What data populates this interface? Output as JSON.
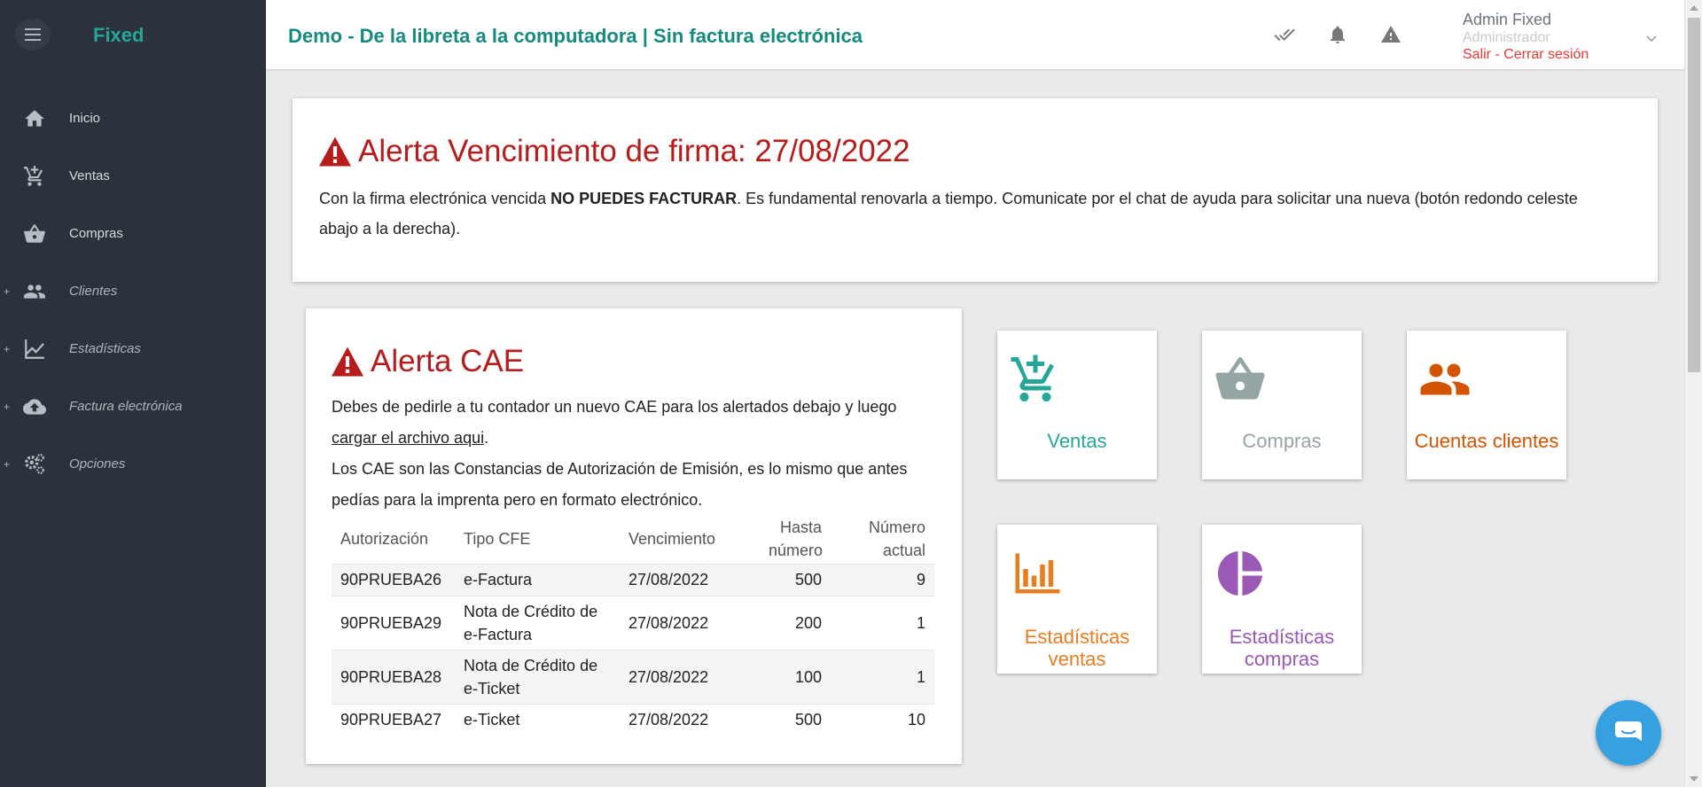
{
  "sidebar": {
    "brand": "Fixed",
    "items": [
      {
        "label": "Inicio",
        "icon": "home-icon",
        "expandable": false
      },
      {
        "label": "Ventas",
        "icon": "cart-plus-icon",
        "expandable": false
      },
      {
        "label": "Compras",
        "icon": "basket-icon",
        "expandable": false
      },
      {
        "label": "Clientes",
        "icon": "people-icon",
        "expandable": true
      },
      {
        "label": "Estadísticas",
        "icon": "chart-line-icon",
        "expandable": true
      },
      {
        "label": "Factura electrónica",
        "icon": "cloud-upload-icon",
        "expandable": true
      },
      {
        "label": "Opciones",
        "icon": "gears-icon",
        "expandable": true
      }
    ],
    "expand_symbol": "+"
  },
  "header": {
    "title": "Demo - De la libreta a la computadora | Sin factura electrónica",
    "icons": [
      "double-check-icon",
      "bell-icon",
      "warning-icon"
    ],
    "user": {
      "name": "Admin Fixed",
      "role": "Administrador",
      "logout": "Salir - Cerrar sesión"
    }
  },
  "alert_firma": {
    "title": "Alerta Vencimiento de firma: 27/08/2022",
    "text_before": "Con la firma electrónica vencida ",
    "text_bold": "NO PUEDES FACTURAR",
    "text_after": ". Es fundamental renovarla a tiempo. Comunicate por el chat de ayuda para solicitar una nueva (botón redondo celeste abajo a la derecha)."
  },
  "alert_cae": {
    "title": "Alerta CAE",
    "text1": "Debes de pedirle a tu contador un nuevo CAE para los alertados debajo y luego",
    "link": "cargar el archivo aqui",
    "link_after": ".",
    "text2": "Los CAE son las Constancias de Autorización de Emisión, es lo mismo que antes pedías para la imprenta pero en formato electrónico.",
    "table": {
      "headers": [
        "Autorización",
        "Tipo CFE",
        "Vencimiento",
        "Hasta número",
        "Número actual"
      ],
      "rows": [
        [
          "90PRUEBA26",
          "e-Factura",
          "27/08/2022",
          "500",
          "9"
        ],
        [
          "90PRUEBA29",
          "Nota de Crédito de e-Factura",
          "27/08/2022",
          "200",
          "1"
        ],
        [
          "90PRUEBA28",
          "Nota de Crédito de e-Ticket",
          "27/08/2022",
          "100",
          "1"
        ],
        [
          "90PRUEBA27",
          "e-Ticket",
          "27/08/2022",
          "500",
          "10"
        ]
      ]
    }
  },
  "tiles": [
    {
      "label": "Ventas",
      "icon": "cart-plus-icon",
      "color": "#26a69a"
    },
    {
      "label": "Compras",
      "icon": "basket-icon",
      "color": "#95a5a6"
    },
    {
      "label": "Cuentas clientes",
      "icon": "people-icon",
      "color": "#d35400"
    },
    {
      "label": "Estadísticas ventas",
      "icon": "bar-chart-icon",
      "color": "#e67e22"
    },
    {
      "label": "Estadísticas compras",
      "icon": "pie-chart-icon",
      "color": "#9b59b6"
    }
  ],
  "colors": {
    "sidebar_bg": "#2b323b",
    "brand": "#26a69a",
    "alert_red": "#b71c1c",
    "logout_red": "#e53935",
    "chat": "#36a0e0"
  },
  "chat": {
    "icon": "chat-icon"
  }
}
